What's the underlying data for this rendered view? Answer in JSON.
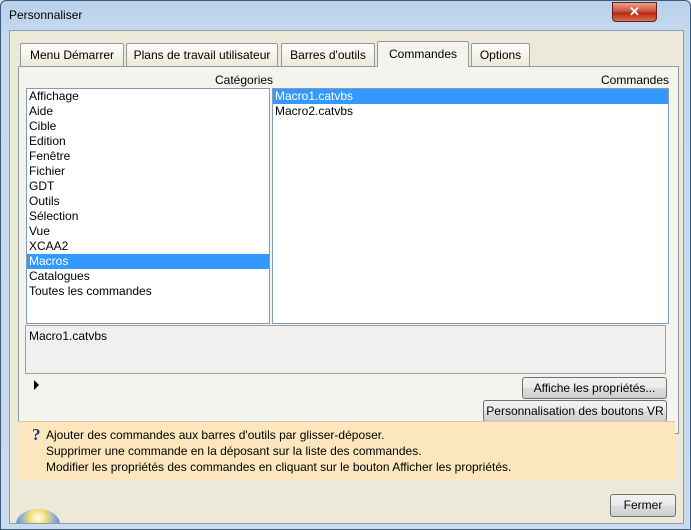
{
  "window": {
    "title": "Personnaliser",
    "close_label": "✕"
  },
  "tabs": [
    {
      "label": "Menu Démarrer",
      "active": false
    },
    {
      "label": "Plans de travail utilisateur",
      "active": false
    },
    {
      "label": "Barres d'outils",
      "active": false
    },
    {
      "label": "Commandes",
      "active": true
    },
    {
      "label": "Options",
      "active": false
    }
  ],
  "categories": {
    "header": "Catégories",
    "items": [
      "Affichage",
      "Aide",
      "Cible",
      "Edition",
      "Fenêtre",
      "Fichier",
      "GDT",
      "Outils",
      "Sélection",
      "Vue",
      "XCAA2",
      "Macros",
      "Catalogues",
      "Toutes les commandes"
    ],
    "selected": "Macros"
  },
  "commands": {
    "header": "Commandes",
    "items": [
      "Macro1.catvbs",
      "Macro2.catvbs"
    ],
    "selected": "Macro1.catvbs"
  },
  "description": {
    "text": "Macro1.catvbs"
  },
  "buttons": {
    "properties": "Affiche les propriétés...",
    "vr": "Personnalisation des boutons VR",
    "close": "Fermer"
  },
  "info": {
    "icon": "question-icon",
    "lines": [
      "Ajouter des commandes aux barres d'outils par glisser-déposer.",
      "Supprimer une commande en la déposant sur la liste des commandes.",
      "Modifier les propriétés des commandes en cliquant sur le bouton Afficher les propriétés."
    ]
  }
}
